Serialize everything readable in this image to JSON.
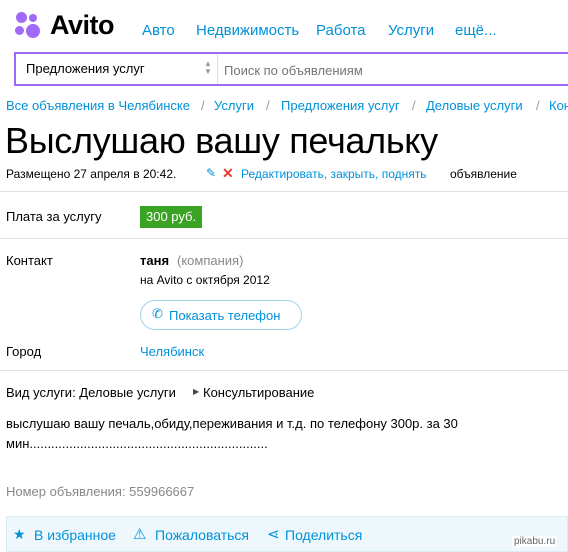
{
  "brand": {
    "name": "Avito",
    "dot_colors": [
      "#97cf26",
      "#a169f7",
      "#ff6163",
      "#00aaff"
    ]
  },
  "nav": {
    "items": [
      "Авто",
      "Недвижимость",
      "Работа",
      "Услуги",
      "ещё..."
    ]
  },
  "search": {
    "category_value": "Предложения услуг",
    "placeholder": "Поиск по объявлениям"
  },
  "breadcrumbs": [
    "Все объявления в Челябинске",
    "Услуги",
    "Предложения услуг",
    "Деловые услуги",
    "Кон"
  ],
  "ad": {
    "title": "Выслушаю вашу печальку",
    "posted": "Размещено 27 апреля в 20:42.",
    "edit_link": "Редактировать, закрыть, поднять",
    "edit_suffix": "объявление",
    "price_label": "Плата за услугу",
    "price": "300 руб.",
    "contact_label": "Контакт",
    "contact_name": "таня",
    "contact_type": "(компания)",
    "contact_since": "на Avito с октября 2012",
    "show_phone": "Показать телефон",
    "city_label": "Город",
    "city": "Челябинск",
    "service_type_prefix": "Вид услуги: Деловые услуги",
    "service_type_sub": "Консультирование",
    "description_line1": "выслушаю вашу печаль,обиду,переживания и т.д. по телефону 300р. за 30",
    "description_line2": "мин..................................................................",
    "ad_number": "Номер объявления: 559966667"
  },
  "actions": {
    "favorite": "В избранное",
    "report": "Пожаловаться",
    "share": "Поделиться"
  },
  "watermark": "pikabu.ru",
  "colors": {
    "link": "#0091d9",
    "price_bg": "#3aa324",
    "search_border": "#a169f7",
    "delete": "#e53935"
  }
}
